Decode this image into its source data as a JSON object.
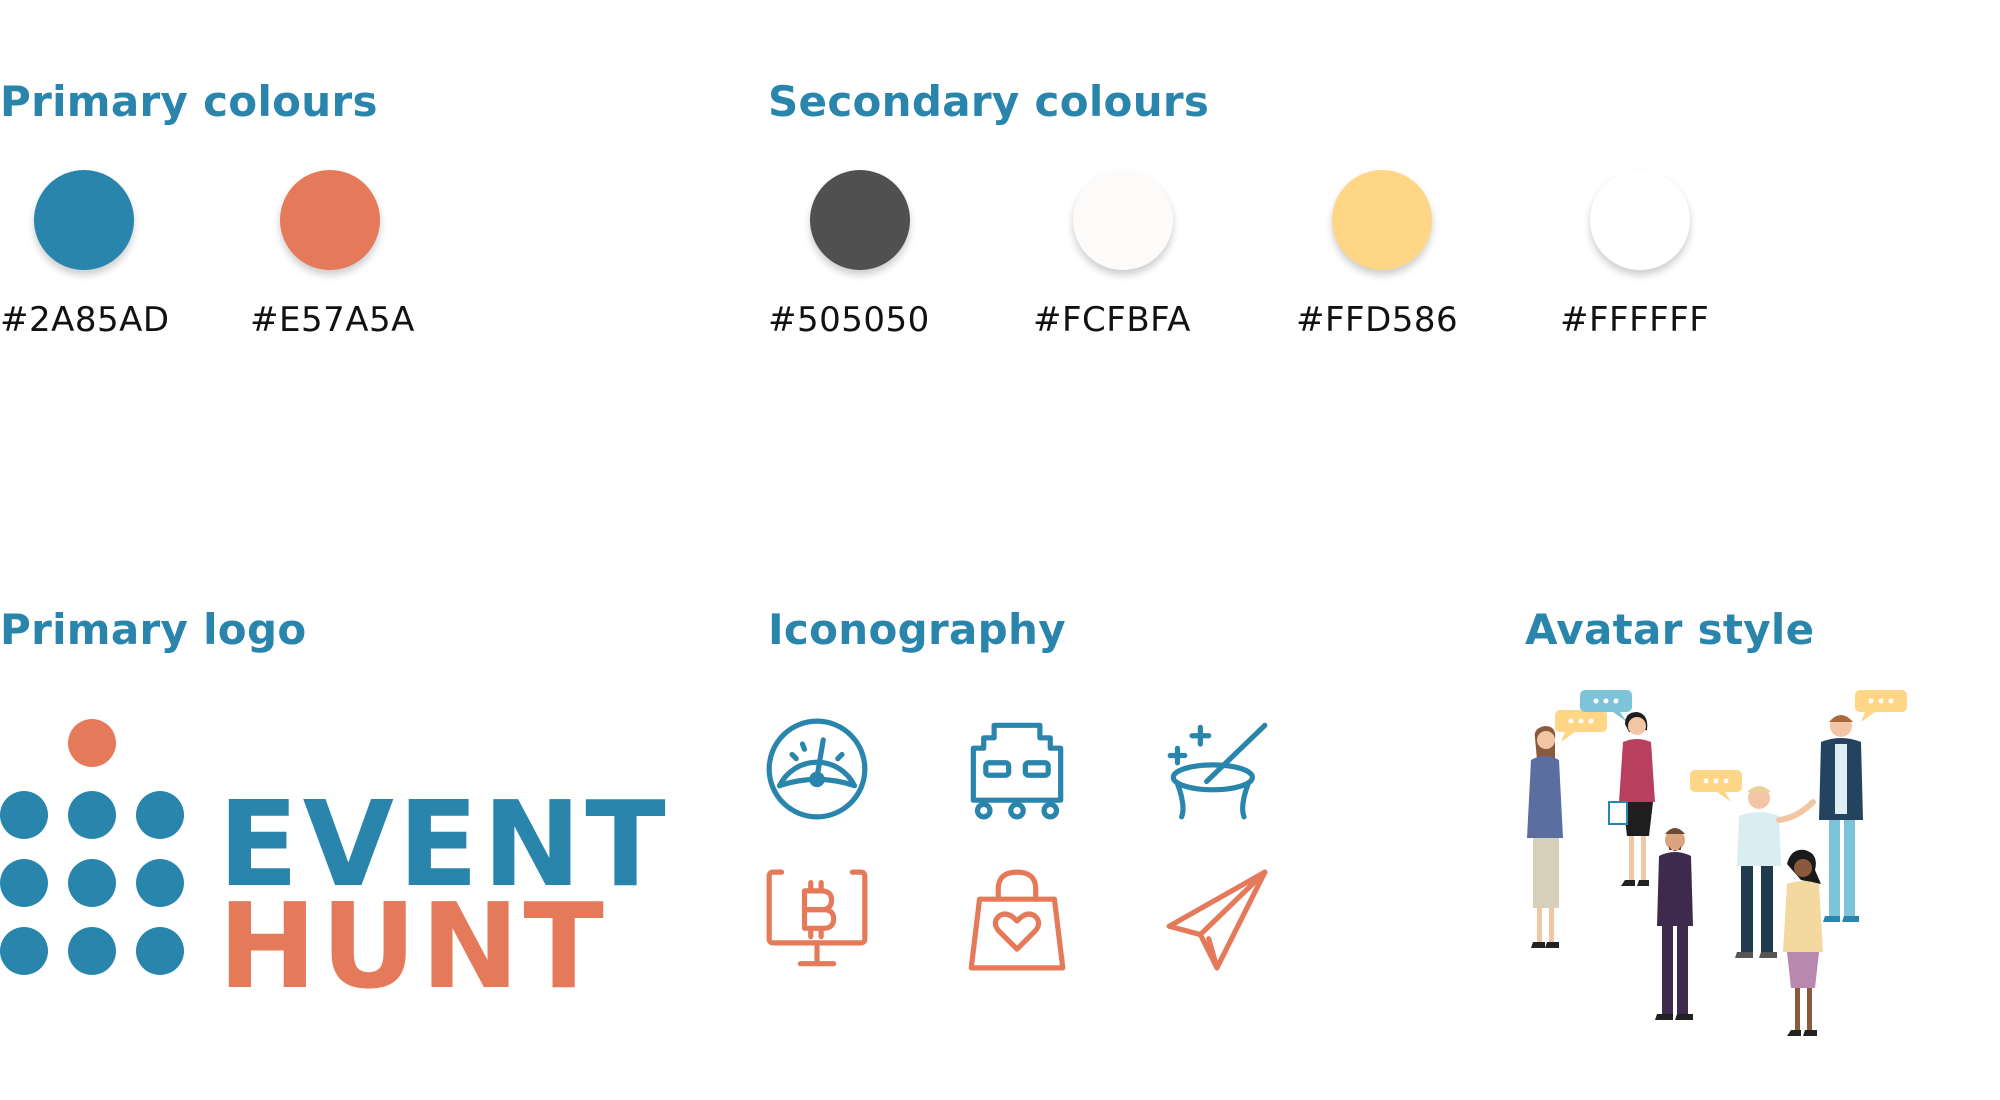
{
  "primary_colours": {
    "title": "Primary colours",
    "swatches": [
      {
        "hex": "#2A85AD",
        "color": "#2A85AD"
      },
      {
        "hex": "#E57A5A",
        "color": "#E57A5A"
      }
    ]
  },
  "secondary_colours": {
    "title": "Secondary colours",
    "swatches": [
      {
        "hex": "#505050",
        "color": "#505050"
      },
      {
        "hex": "#FCFBFA",
        "color": "#FCFBFA"
      },
      {
        "hex": "#FFD586",
        "color": "#FFD586"
      },
      {
        "hex": "#FFFFFF",
        "color": "#FFFFFF"
      }
    ]
  },
  "primary_logo": {
    "title": "Primary logo",
    "word_top": "EVENT",
    "word_bottom": "HUNT",
    "dot_color": "#E57A5A",
    "grid_color": "#2A85AD"
  },
  "iconography": {
    "title": "Iconography",
    "icons": [
      {
        "name": "speedometer-icon",
        "color": "#2A85AD"
      },
      {
        "name": "robot-car-icon",
        "color": "#2A85AD"
      },
      {
        "name": "magic-hat-icon",
        "color": "#2A85AD"
      },
      {
        "name": "bitcoin-monitor-icon",
        "color": "#E57A5A"
      },
      {
        "name": "shopping-bag-heart-icon",
        "color": "#E57A5A"
      },
      {
        "name": "paper-plane-icon",
        "color": "#E57A5A"
      }
    ]
  },
  "avatar_style": {
    "title": "Avatar style"
  }
}
